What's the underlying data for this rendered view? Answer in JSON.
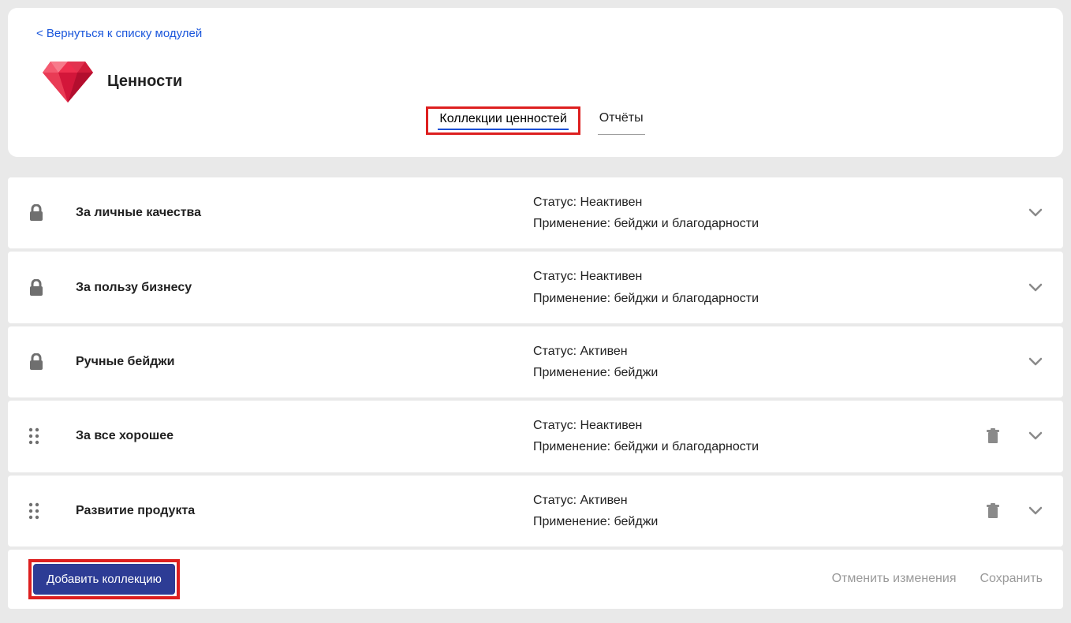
{
  "back_link": "< Вернуться к списку модулей",
  "module_title": "Ценности",
  "tabs": {
    "collections": "Коллекции ценностей",
    "reports": "Отчёты"
  },
  "labels": {
    "status_prefix": "Статус: ",
    "usage_prefix": "Применение: "
  },
  "rows": [
    {
      "locked": true,
      "title": "За личные качества",
      "status": "Неактивен",
      "usage": "бейджи и благодарности",
      "deletable": false
    },
    {
      "locked": true,
      "title": "За пользу бизнесу",
      "status": "Неактивен",
      "usage": "бейджи и благодарности",
      "deletable": false
    },
    {
      "locked": true,
      "title": "Ручные бейджи",
      "status": "Активен",
      "usage": "бейджи",
      "deletable": false
    },
    {
      "locked": false,
      "title": "За все хорошее",
      "status": "Неактивен",
      "usage": "бейджи и благодарности",
      "deletable": true
    },
    {
      "locked": false,
      "title": "Развитие продукта",
      "status": "Активен",
      "usage": "бейджи",
      "deletable": true
    }
  ],
  "footer": {
    "add": "Добавить коллекцию",
    "cancel": "Отменить изменения",
    "save": "Сохранить"
  }
}
